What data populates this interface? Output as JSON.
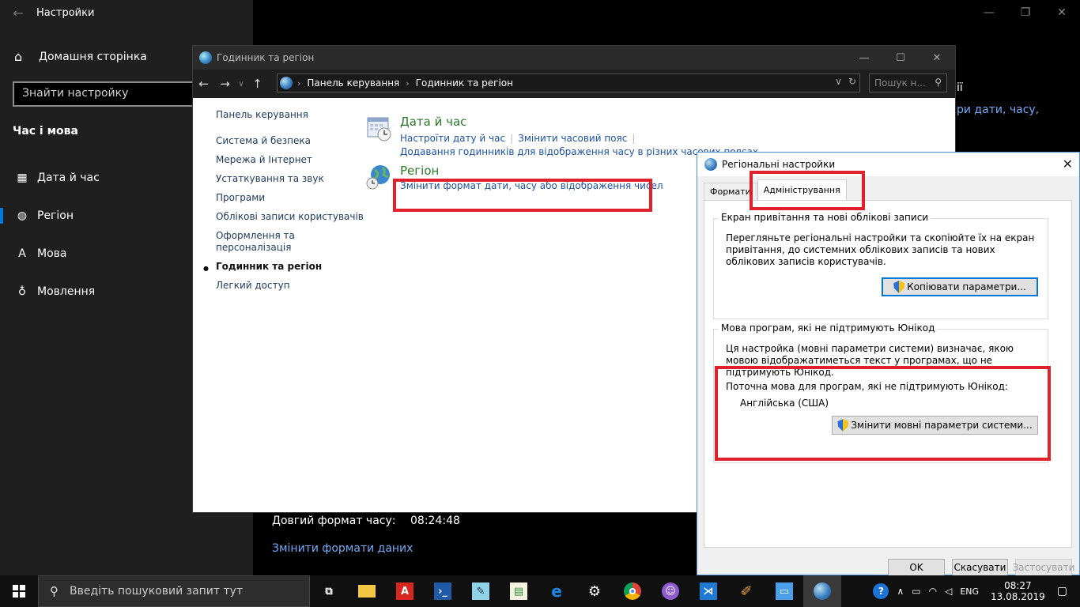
{
  "settings": {
    "window_title": "Настройки",
    "home_label": "Домашня сторінка",
    "search_placeholder": "Знайти настройку",
    "section_title": "Час і мова",
    "nav": [
      {
        "label": "Дата й час",
        "icon": "calendar-icon"
      },
      {
        "label": "Регіон",
        "icon": "globe-region-icon"
      },
      {
        "label": "Мова",
        "icon": "language-icon"
      },
      {
        "label": "Мовлення",
        "icon": "microphone-icon"
      }
    ],
    "active_nav": "Регіон",
    "right_partial_1": "ії",
    "right_partial_2": "ри дати, часу,",
    "long_time_label": "Довгий формат часу:",
    "long_time_value": "08:24:48",
    "change_formats_link": "Змінити формати даних"
  },
  "control_panel": {
    "title": "Годинник та регіон",
    "breadcrumb": [
      "Панель керування",
      "Годинник та регіон"
    ],
    "search_placeholder": "Пошук н...",
    "left_nav": [
      "Панель керування",
      "Система й безпека",
      "Мережа й Інтернет",
      "Устаткування та звук",
      "Програми",
      "Облікові записи користувачів",
      "Оформлення та персоналізація",
      "Годинник та регіон",
      "Легкий доступ"
    ],
    "active_left": "Годинник та регіон",
    "date_time": {
      "title": "Дата й час",
      "link1": "Настроїти дату й час",
      "link2": "Змінити часовий пояс",
      "link3": "Додавання годинників для відображення часу в різних часових поясах"
    },
    "region": {
      "title": "Регіон",
      "link1": "Змінити формат дати, часу або відображення чисел"
    }
  },
  "regional_dialog": {
    "title": "Регіональні настройки",
    "tabs": [
      "Формати",
      "Адміністрування"
    ],
    "selected_tab": "Адміністрування",
    "group1": {
      "legend": "Екран привітання та нові облікові записи",
      "text": "Перегляньте регіональні настройки та скопіюйте їх на екран привітання, до системних облікових записів та нових облікових записів користувачів.",
      "button": "Копіювати параметри..."
    },
    "group2": {
      "legend": "Мова програм, які не підтримують Юнікод",
      "text": "Ця настройка (мовні параметри системи) визначає, якою мовою відображатиметься текст у програмах, що не підтримують Юнікод.",
      "current_label": "Поточна мова для програм, які не підтримують Юнікод:",
      "current_value": "Англійська (США)",
      "button": "Змінити мовні параметри системи..."
    },
    "ok": "OK",
    "cancel": "Скасувати",
    "apply": "Застосувати"
  },
  "taskbar": {
    "search_placeholder": "Введіть пошуковий запит тут",
    "lang": "ENG",
    "time": "08:27",
    "date": "13.08.2019",
    "pinned_icons": [
      "task-view-icon",
      "file-explorer-icon",
      "acrobat-icon",
      "powershell-icon",
      "notepad-icon",
      "spreadsheet-icon",
      "edge-icon",
      "settings-gear-icon",
      "chrome-icon",
      "cat-app-icon",
      "vscode-icon",
      "paint-icon",
      "remote-desktop-icon",
      "region-globe-icon"
    ]
  },
  "colors": {
    "accent": "#0078d7",
    "highlight_box": "#e0202a",
    "cp_link": "#1f52a3",
    "cp_category_title": "#2a7a2a"
  }
}
